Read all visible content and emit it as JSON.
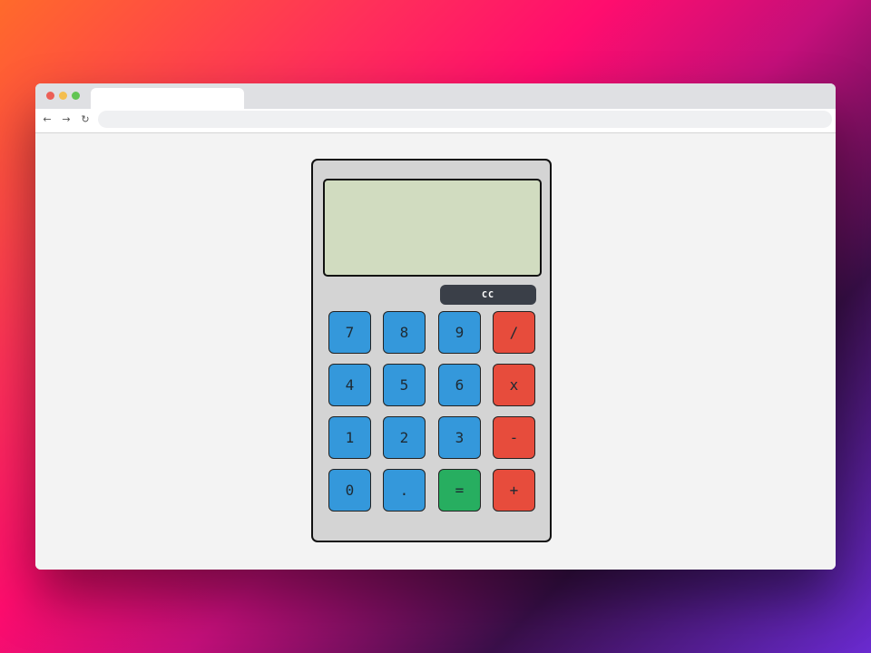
{
  "browser": {
    "tab_title": "",
    "url": "",
    "nav_icons": [
      "arrow-left-icon",
      "arrow-right-icon",
      "reload-icon"
    ]
  },
  "calculator": {
    "display_value": "",
    "clear_label": "CC",
    "keys": {
      "k7": "7",
      "k8": "8",
      "k9": "9",
      "divide": "/",
      "k4": "4",
      "k5": "5",
      "k6": "6",
      "multiply": "x",
      "k1": "1",
      "k2": "2",
      "k3": "3",
      "subtract": "-",
      "k0": "0",
      "decimal": ".",
      "equals": "=",
      "add": "+"
    },
    "colors": {
      "body": "#d4d4d4",
      "display": "#d1dcc0",
      "number_key": "#3498db",
      "operator_key": "#e74c3c",
      "equals_key": "#27ae60",
      "clear_key": "#3a3f48"
    }
  }
}
